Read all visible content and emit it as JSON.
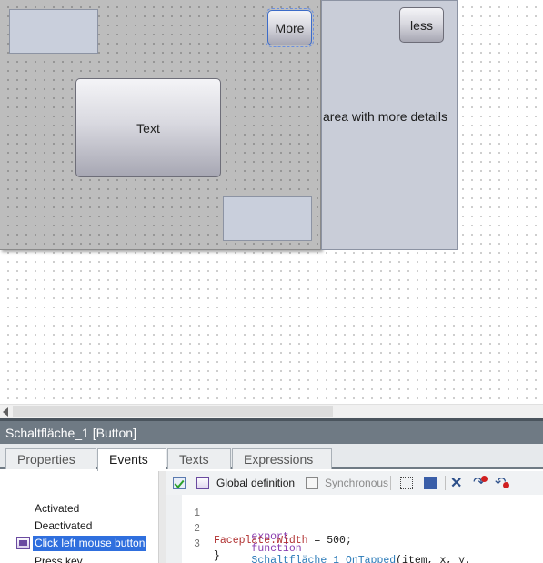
{
  "canvas": {
    "more_button": "More",
    "text_button": "Text",
    "less_button": "less",
    "details_text": "area with more details"
  },
  "inspector": {
    "title": "Schaltfläche_1 [Button]",
    "tabs": [
      "Properties",
      "Events",
      "Texts",
      "Expressions"
    ],
    "active_tab": "Events",
    "events": [
      "Activated",
      "Deactivated",
      "Click left mouse button",
      "Press key"
    ],
    "selected_event": "Click left mouse button",
    "toolbar": {
      "global_definition": "Global definition",
      "synchronous": "Synchronous"
    },
    "code": {
      "line_numbers": [
        "1",
        "2",
        "3"
      ],
      "line1": {
        "keyword1": "export",
        "keyword2": "function",
        "fn_name": "Schaltfläche_1_OnTapped",
        "params": "(item, x, y,"
      },
      "line2": {
        "object": "Faceplate.Width",
        "op": " = ",
        "value": "500",
        "end": ";"
      },
      "line3": "}"
    }
  },
  "colors": {
    "selection": "#2f6fde",
    "title_bar": "#6f7a84",
    "code_keyword": "#8a3fb0",
    "code_function": "#2a7ab8",
    "code_object": "#b03030"
  }
}
